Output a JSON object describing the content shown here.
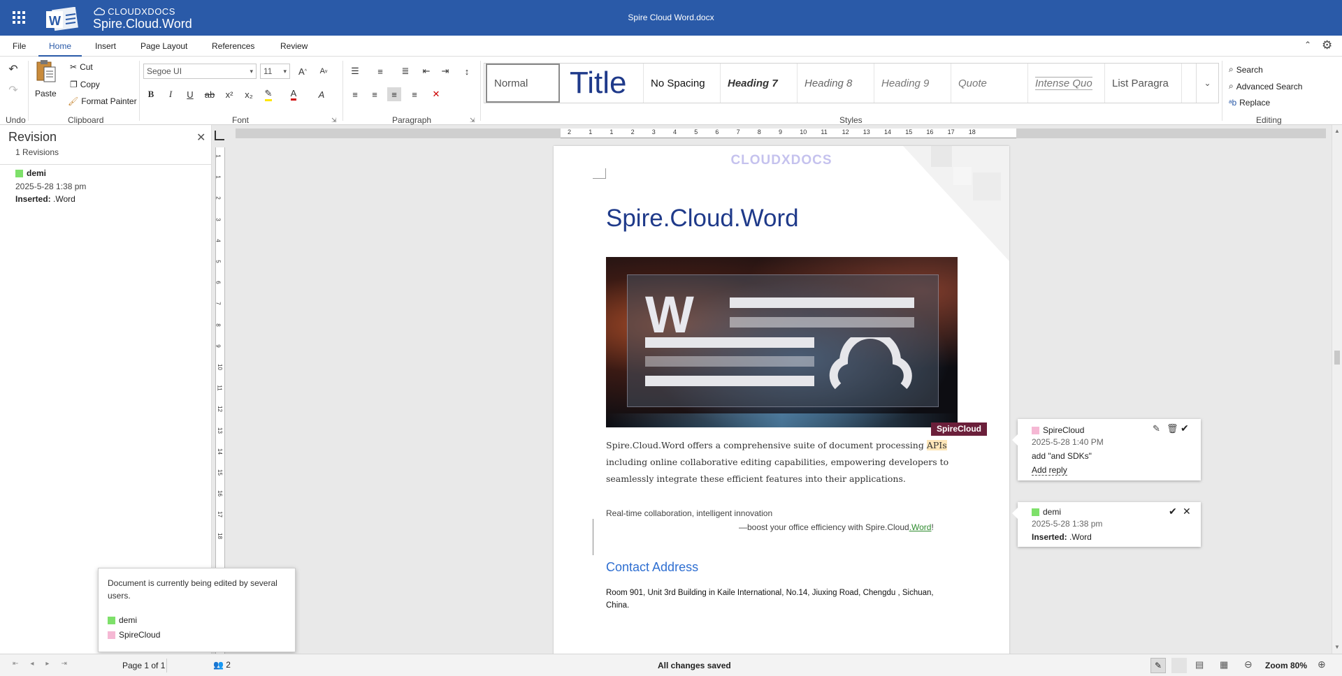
{
  "app": {
    "brand_small": "CLOUDXDOCS",
    "brand_big": "Spire.Cloud.Word",
    "document_title": "Spire Cloud Word.docx"
  },
  "menu": {
    "tabs": [
      "File",
      "Home",
      "Insert",
      "Page Layout",
      "References",
      "Review"
    ],
    "active": "Home"
  },
  "ribbon": {
    "undo_label": "Undo",
    "paste_label": "Paste",
    "cut_label": "Cut",
    "copy_label": "Copy",
    "format_painter_label": "Format Painter",
    "clipboard_label": "Clipboard",
    "font_name": "Segoe UI",
    "font_size": "11",
    "font_label": "Font",
    "paragraph_label": "Paragraph",
    "styles_label": "Styles",
    "editing_label": "Editing",
    "search_label": "Search",
    "advanced_search_label": "Advanced Search",
    "replace_label": "Replace",
    "styles": [
      "Normal",
      "Title",
      "No Spacing",
      "Heading 7",
      "Heading 8",
      "Heading 9",
      "Quote",
      "Intense Quo",
      "List Paragra"
    ],
    "format_buttons": {
      "bold": "B",
      "italic": "I",
      "underline": "U",
      "strike": "ab",
      "sup": "x²",
      "sub": "x₂"
    }
  },
  "revision_panel": {
    "title": "Revision",
    "count": "1 Revisions",
    "items": [
      {
        "author": "demi",
        "date": "2025-5-28 1:38 pm",
        "type_label": "Inserted:",
        "value": ".Word",
        "color": "#7ee06a"
      }
    ]
  },
  "document": {
    "watermark": "CLOUDXDOCS",
    "heading": "Spire.Cloud.Word",
    "image_letter": "W",
    "paragraph_lines": [
      "Spire.Cloud.Word offers a comprehensive suite of document processing ",
      "including online collaborative editing capabilities, empowering developers to",
      "seamlessly integrate these efficient features into their applications."
    ],
    "highlighted_word": "APIs",
    "comment_flag": "SpireCloud",
    "tagline": "Real-time collaboration, intelligent innovation",
    "boost_prefix": "—boost your office efficiency with Spire.Cloud",
    "boost_inserted": ".Word",
    "boost_suffix": "!",
    "contact_heading": "Contact Address",
    "address_lines": [
      "Room 901, Unit 3rd Building in Kaile International, No.14, Jiuxing Road, Chengdu , Sichuan,",
      "China."
    ]
  },
  "comments": [
    {
      "author": "SpireCloud",
      "date": "2025-5-28 1:40 PM",
      "text": "add \"and SDKs\"",
      "reply_label": "Add reply",
      "color": "#f5b8d4"
    },
    {
      "author": "demi",
      "date": "2025-5-28 1:38 pm",
      "type_label": "Inserted:",
      "value": ".Word",
      "color": "#7ee06a"
    }
  ],
  "collab_popup": {
    "message": "Document is currently being edited by several users.",
    "users": [
      {
        "name": "demi",
        "color": "#7ee06a"
      },
      {
        "name": "SpireCloud",
        "color": "#f5b8d4"
      }
    ]
  },
  "status": {
    "page": "Page 1 of 1",
    "users_count": "2",
    "saved": "All changes saved",
    "zoom": "Zoom 80%"
  },
  "colors": {
    "brand": "#2a5aa8",
    "heading": "#1f3a8a",
    "accent_link": "#2f6fd1",
    "comment_flag": "#6b1f3a"
  },
  "ruler_numbers": [
    "2",
    "1",
    "1",
    "2",
    "3",
    "4",
    "5",
    "6",
    "7",
    "8",
    "9",
    "10",
    "11",
    "12",
    "13",
    "14",
    "15",
    "16",
    "17",
    "18"
  ],
  "vruler_numbers": [
    "1",
    "1",
    "2",
    "3",
    "4",
    "5",
    "6",
    "7",
    "8",
    "9",
    "10",
    "11",
    "12",
    "13",
    "14",
    "15",
    "16",
    "17",
    "18"
  ]
}
